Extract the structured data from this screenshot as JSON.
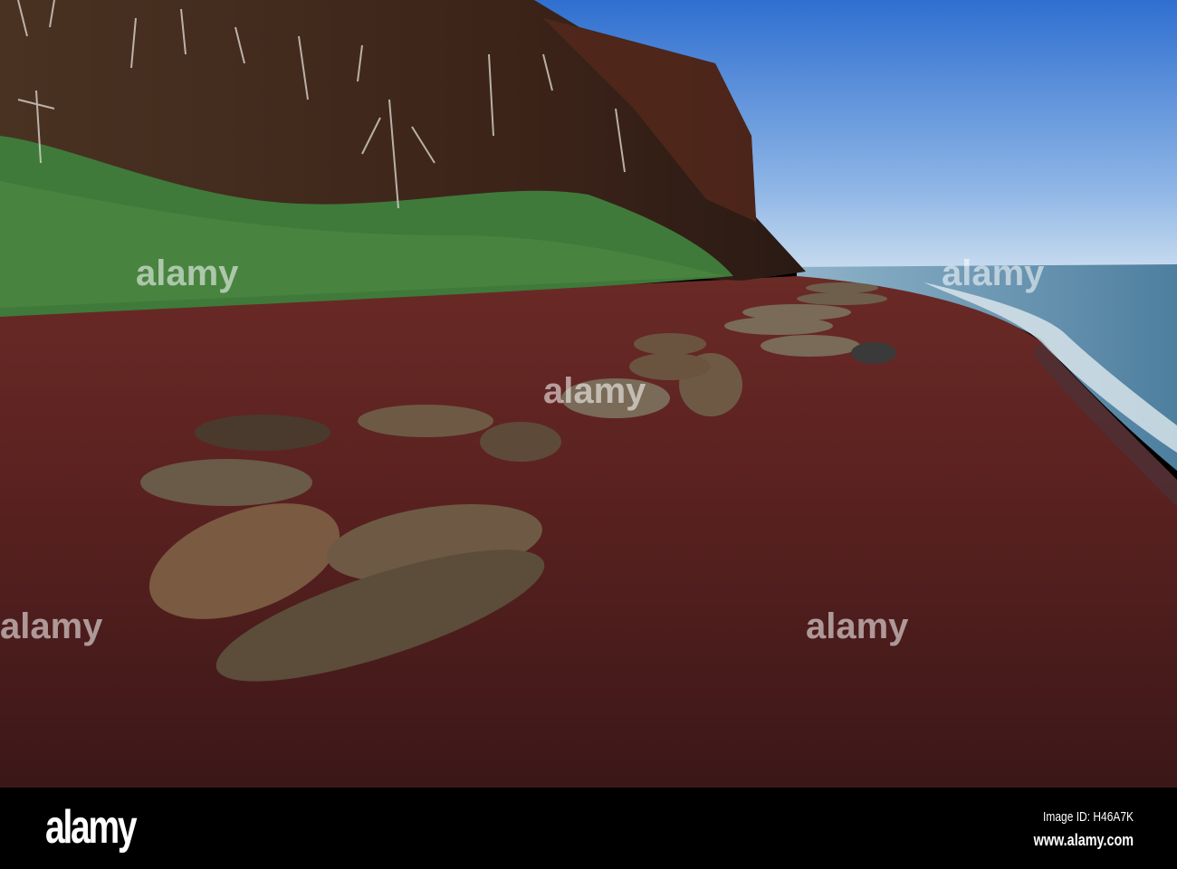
{
  "footer": {
    "brand": "alamy",
    "image_id": "Image ID: H46A7K",
    "url": "www.alamy.com"
  },
  "watermark": "alamy",
  "colors": {
    "sky": "#3f7fd6",
    "sand": "#5a2020",
    "cliff": "#3a2418",
    "vegetation": "#3f7a3a",
    "sea": "#5f8fae"
  }
}
